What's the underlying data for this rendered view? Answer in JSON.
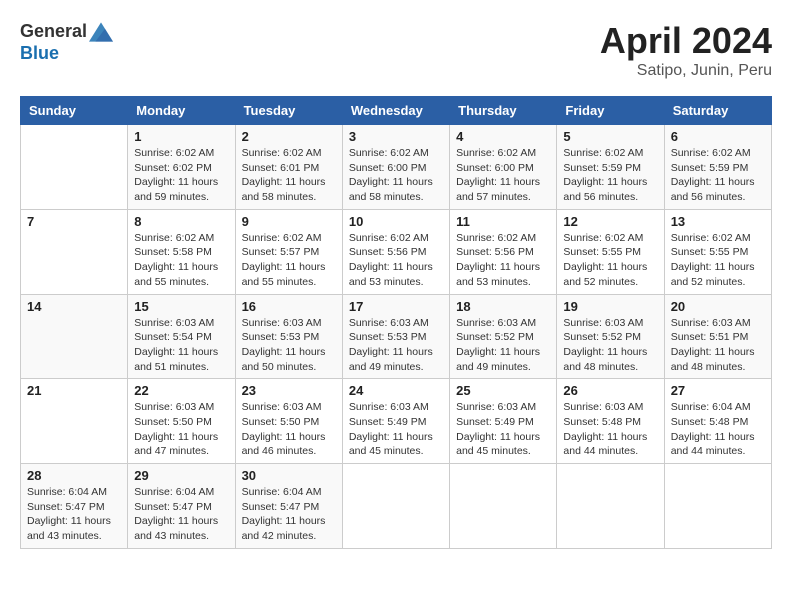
{
  "header": {
    "logo_general": "General",
    "logo_blue": "Blue",
    "month_title": "April 2024",
    "location": "Satipo, Junin, Peru"
  },
  "calendar": {
    "days_of_week": [
      "Sunday",
      "Monday",
      "Tuesday",
      "Wednesday",
      "Thursday",
      "Friday",
      "Saturday"
    ],
    "weeks": [
      [
        {
          "day": "",
          "info": ""
        },
        {
          "day": "1",
          "info": "Sunrise: 6:02 AM\nSunset: 6:02 PM\nDaylight: 11 hours\nand 59 minutes."
        },
        {
          "day": "2",
          "info": "Sunrise: 6:02 AM\nSunset: 6:01 PM\nDaylight: 11 hours\nand 58 minutes."
        },
        {
          "day": "3",
          "info": "Sunrise: 6:02 AM\nSunset: 6:00 PM\nDaylight: 11 hours\nand 58 minutes."
        },
        {
          "day": "4",
          "info": "Sunrise: 6:02 AM\nSunset: 6:00 PM\nDaylight: 11 hours\nand 57 minutes."
        },
        {
          "day": "5",
          "info": "Sunrise: 6:02 AM\nSunset: 5:59 PM\nDaylight: 11 hours\nand 56 minutes."
        },
        {
          "day": "6",
          "info": "Sunrise: 6:02 AM\nSunset: 5:59 PM\nDaylight: 11 hours\nand 56 minutes."
        }
      ],
      [
        {
          "day": "7",
          "info": ""
        },
        {
          "day": "8",
          "info": "Sunrise: 6:02 AM\nSunset: 5:58 PM\nDaylight: 11 hours\nand 55 minutes."
        },
        {
          "day": "9",
          "info": "Sunrise: 6:02 AM\nSunset: 5:57 PM\nDaylight: 11 hours\nand 55 minutes."
        },
        {
          "day": "10",
          "info": "Sunrise: 6:02 AM\nSunset: 5:56 PM\nDaylight: 11 hours\nand 53 minutes."
        },
        {
          "day": "11",
          "info": "Sunrise: 6:02 AM\nSunset: 5:56 PM\nDaylight: 11 hours\nand 53 minutes."
        },
        {
          "day": "12",
          "info": "Sunrise: 6:02 AM\nSunset: 5:55 PM\nDaylight: 11 hours\nand 52 minutes."
        },
        {
          "day": "13",
          "info": "Sunrise: 6:02 AM\nSunset: 5:55 PM\nDaylight: 11 hours\nand 52 minutes."
        }
      ],
      [
        {
          "day": "14",
          "info": ""
        },
        {
          "day": "15",
          "info": "Sunrise: 6:03 AM\nSunset: 5:54 PM\nDaylight: 11 hours\nand 51 minutes."
        },
        {
          "day": "16",
          "info": "Sunrise: 6:03 AM\nSunset: 5:53 PM\nDaylight: 11 hours\nand 50 minutes."
        },
        {
          "day": "17",
          "info": "Sunrise: 6:03 AM\nSunset: 5:53 PM\nDaylight: 11 hours\nand 49 minutes."
        },
        {
          "day": "18",
          "info": "Sunrise: 6:03 AM\nSunset: 5:52 PM\nDaylight: 11 hours\nand 49 minutes."
        },
        {
          "day": "19",
          "info": "Sunrise: 6:03 AM\nSunset: 5:52 PM\nDaylight: 11 hours\nand 48 minutes."
        },
        {
          "day": "20",
          "info": "Sunrise: 6:03 AM\nSunset: 5:51 PM\nDaylight: 11 hours\nand 48 minutes."
        }
      ],
      [
        {
          "day": "21",
          "info": ""
        },
        {
          "day": "22",
          "info": "Sunrise: 6:03 AM\nSunset: 5:50 PM\nDaylight: 11 hours\nand 47 minutes."
        },
        {
          "day": "23",
          "info": "Sunrise: 6:03 AM\nSunset: 5:50 PM\nDaylight: 11 hours\nand 46 minutes."
        },
        {
          "day": "24",
          "info": "Sunrise: 6:03 AM\nSunset: 5:49 PM\nDaylight: 11 hours\nand 45 minutes."
        },
        {
          "day": "25",
          "info": "Sunrise: 6:03 AM\nSunset: 5:49 PM\nDaylight: 11 hours\nand 45 minutes."
        },
        {
          "day": "26",
          "info": "Sunrise: 6:03 AM\nSunset: 5:48 PM\nDaylight: 11 hours\nand 44 minutes."
        },
        {
          "day": "27",
          "info": "Sunrise: 6:04 AM\nSunset: 5:48 PM\nDaylight: 11 hours\nand 44 minutes."
        }
      ],
      [
        {
          "day": "28",
          "info": "Sunrise: 6:04 AM\nSunset: 5:47 PM\nDaylight: 11 hours\nand 43 minutes."
        },
        {
          "day": "29",
          "info": "Sunrise: 6:04 AM\nSunset: 5:47 PM\nDaylight: 11 hours\nand 43 minutes."
        },
        {
          "day": "30",
          "info": "Sunrise: 6:04 AM\nSunset: 5:47 PM\nDaylight: 11 hours\nand 42 minutes."
        },
        {
          "day": "",
          "info": ""
        },
        {
          "day": "",
          "info": ""
        },
        {
          "day": "",
          "info": ""
        },
        {
          "day": "",
          "info": ""
        }
      ]
    ]
  }
}
